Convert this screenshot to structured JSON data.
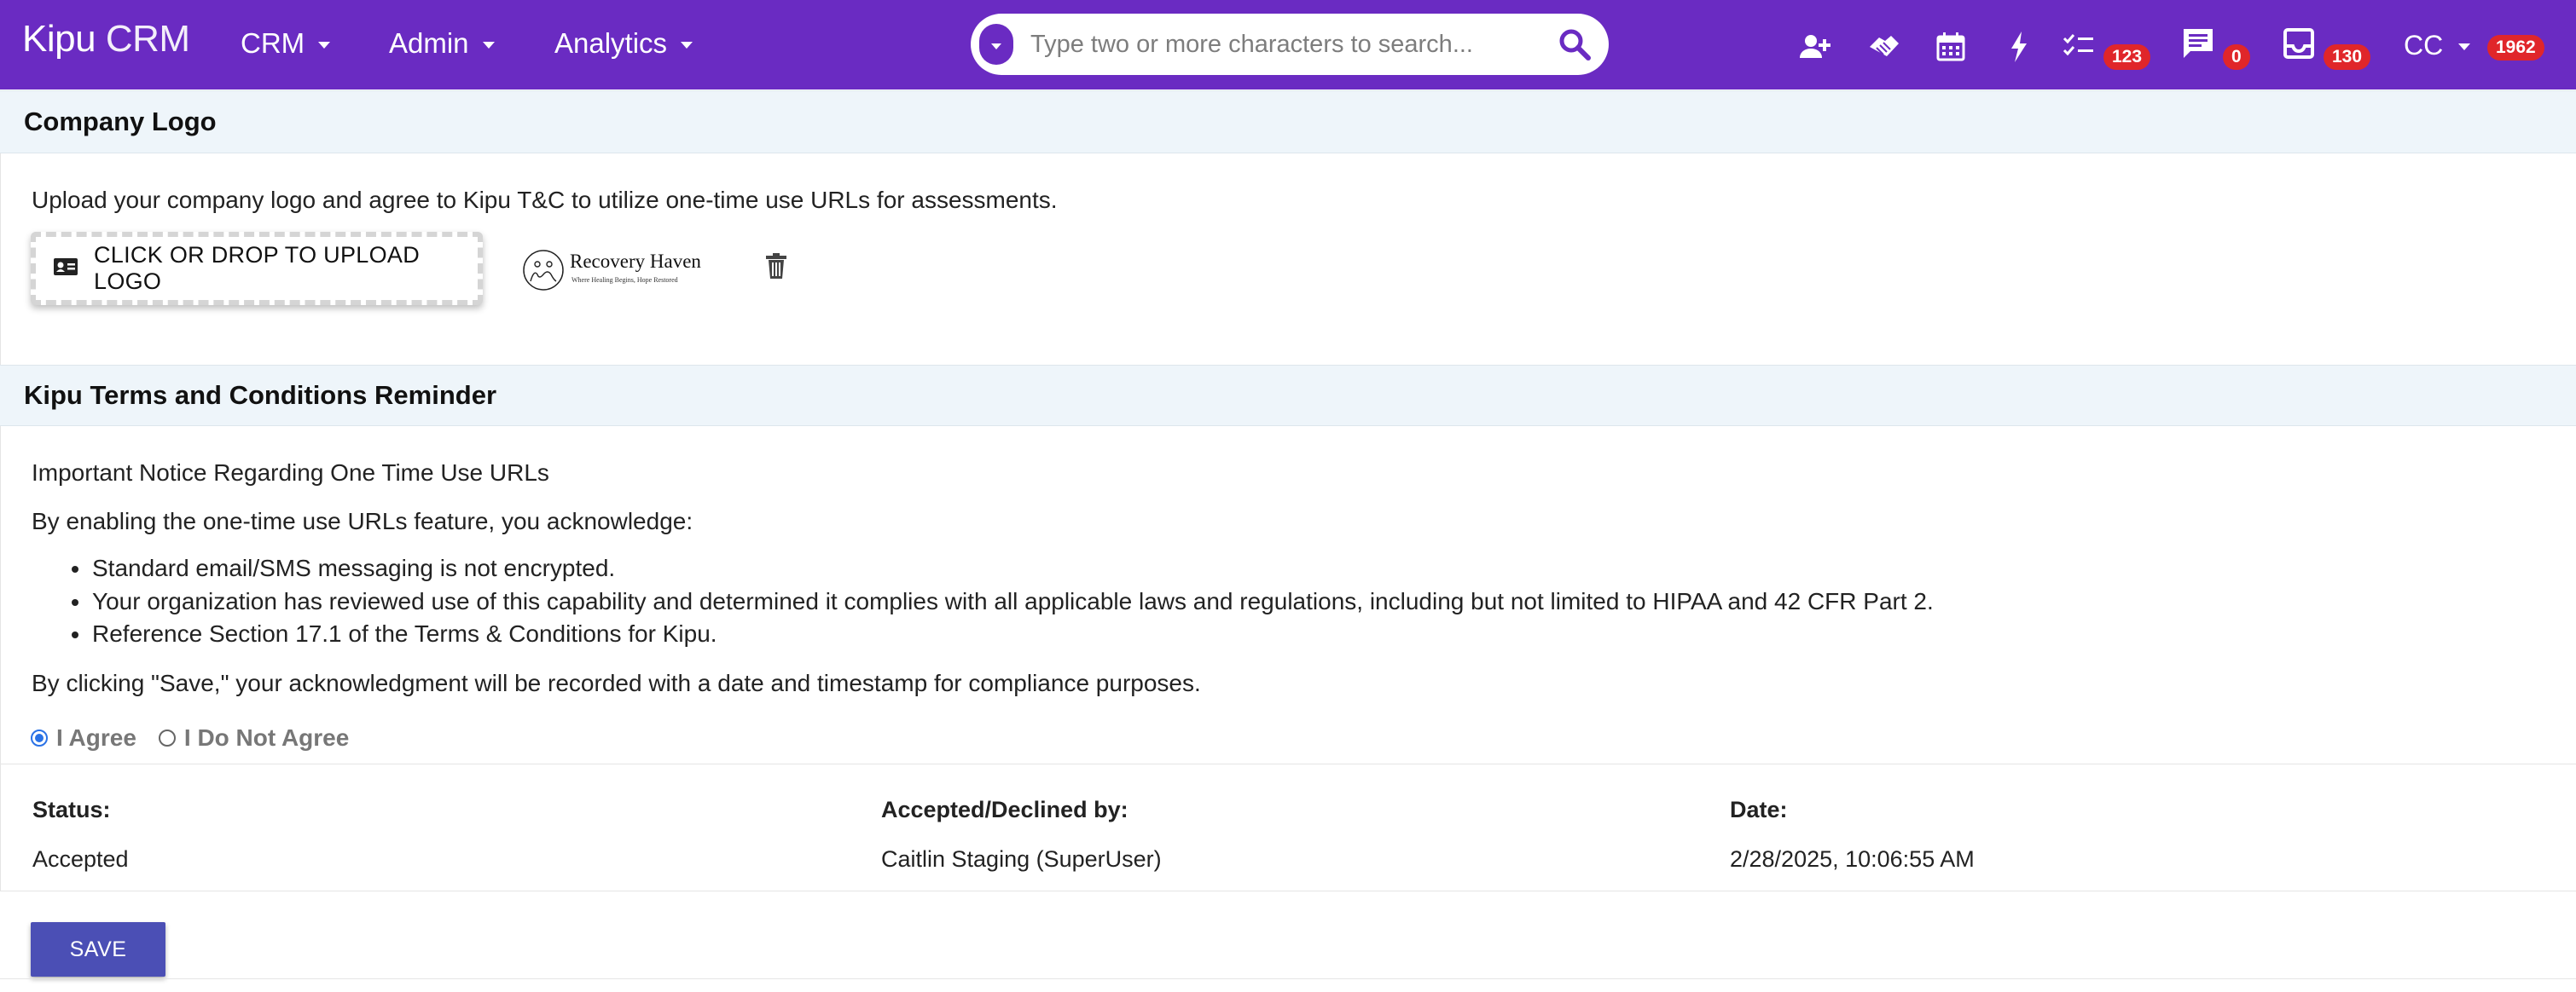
{
  "app": {
    "brand": "Kipu",
    "product": "CRM"
  },
  "nav": [
    {
      "label": "CRM"
    },
    {
      "label": "Admin"
    },
    {
      "label": "Analytics"
    }
  ],
  "search": {
    "placeholder": "Type two or more characters to search..."
  },
  "toolbar": {
    "icons": [
      "add-user-icon",
      "handshake-icon",
      "calendar-icon",
      "lightning-icon",
      "tasks-icon",
      "chat-icon",
      "inbox-icon"
    ],
    "tasks_badge": "123",
    "chat_badge": "0",
    "inbox_badge": "130",
    "user_initials": "CC",
    "user_badge": "1962"
  },
  "colors": {
    "brand": "#6a2bc2",
    "badge": "#e0262a",
    "save": "#4b4fb5",
    "section_bg": "#eef5fa"
  },
  "company_logo": {
    "heading": "Company Logo",
    "description": "Upload your company logo and agree to Kipu T&C to utilize one-time use URLs for assessments.",
    "upload_label": "CLICK OR DROP TO UPLOAD LOGO",
    "logo_name": "Recovery Haven",
    "logo_tagline": "Where Healing Begins, Hope Restored"
  },
  "terms": {
    "heading": "Kipu Terms and Conditions Reminder",
    "notice_title": "Important Notice Regarding One Time Use URLs",
    "intro": "By enabling the one-time use URLs feature, you acknowledge:",
    "bullets": [
      "Standard email/SMS messaging is not encrypted.",
      "Your organization has reviewed use of this capability and determined it complies with all applicable laws and regulations, including but not limited to HIPAA and 42 CFR Part 2.",
      "Reference Section 17.1 of the Terms & Conditions for Kipu."
    ],
    "save_note": "By clicking \"Save,\" your acknowledgment will be recorded with a date and timestamp for compliance purposes.",
    "agree_label": "I Agree",
    "disagree_label": "I Do Not Agree",
    "selected": "agree"
  },
  "status": {
    "status_label": "Status:",
    "status_value": "Accepted",
    "by_label": "Accepted/Declined by:",
    "by_value": "Caitlin Staging (SuperUser)",
    "date_label": "Date:",
    "date_value": "2/28/2025, 10:06:55 AM"
  },
  "actions": {
    "save_label": "SAVE"
  }
}
